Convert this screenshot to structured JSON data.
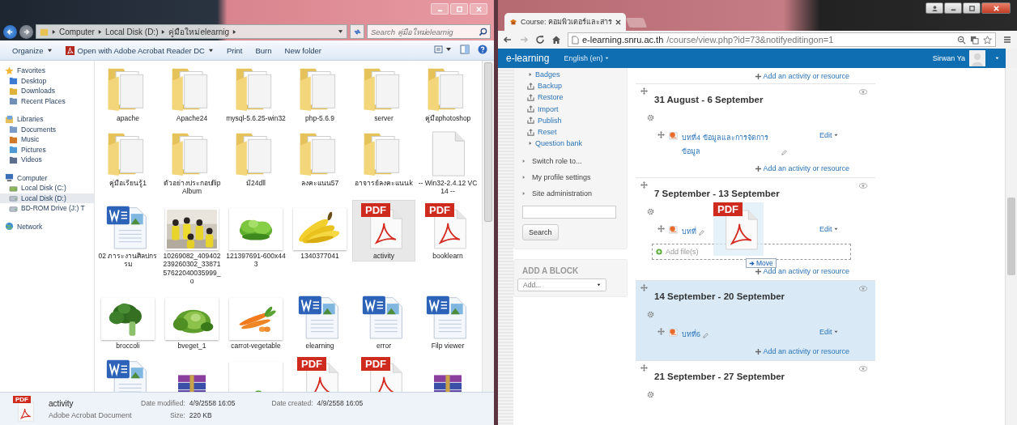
{
  "explorer": {
    "address": {
      "crumbs": [
        "Computer",
        "Local Disk (D:)",
        "คู่มือใหม่elearnig"
      ]
    },
    "search": {
      "placeholder": "Search คู่มือใหม่elearnig"
    },
    "toolbar": [
      {
        "label": "Organize",
        "dropdown": true
      },
      {
        "label": "Open with Adobe Acrobat Reader DC",
        "dropdown": true
      },
      {
        "label": "Print",
        "dropdown": false
      },
      {
        "label": "Burn",
        "dropdown": false
      },
      {
        "label": "New folder",
        "dropdown": false
      }
    ],
    "nav": [
      {
        "label": "Favorites",
        "children": [
          {
            "label": "Desktop",
            "selected": false
          },
          {
            "label": "Downloads",
            "selected": false
          },
          {
            "label": "Recent Places",
            "selected": false
          }
        ]
      },
      {
        "label": "Libraries",
        "children": [
          {
            "label": "Documents",
            "selected": false
          },
          {
            "label": "Music",
            "selected": false
          },
          {
            "label": "Pictures",
            "selected": false
          },
          {
            "label": "Videos",
            "selected": false
          }
        ]
      },
      {
        "label": "Computer",
        "children": [
          {
            "label": "Local Disk (C:)",
            "selected": false
          },
          {
            "label": "Local Disk (D:)",
            "selected": true
          },
          {
            "label": "BD-ROM Drive (J:) T",
            "selected": false
          }
        ]
      },
      {
        "label": "Network"
      }
    ],
    "files": [
      {
        "name": "apache",
        "kind": "folder",
        "selected": false
      },
      {
        "name": "Apache24",
        "kind": "folder",
        "selected": false
      },
      {
        "name": "mysql-5.6.25-win32",
        "kind": "folder",
        "selected": false
      },
      {
        "name": "php-5.6.9",
        "kind": "folder",
        "selected": false
      },
      {
        "name": "server",
        "kind": "folder",
        "selected": false
      },
      {
        "name": "คู่มือphotoshop",
        "kind": "folder",
        "selected": false
      },
      {
        "name": "คู่มือเรียนรู้1",
        "kind": "folder",
        "selected": false
      },
      {
        "name": "ตัวอย่างประกอบflip Album",
        "kind": "folder",
        "selected": false
      },
      {
        "name": "มี24dll",
        "kind": "folder",
        "selected": false
      },
      {
        "name": "ลงคะแนน57",
        "kind": "folder",
        "selected": false
      },
      {
        "name": "อาจารย์ลงคะแนนk",
        "kind": "folder",
        "selected": false
      },
      {
        "name": "-- Win32-2.4.12 VC14 --",
        "kind": "blank",
        "selected": false
      },
      {
        "name": "02 ภาระงานศิลปกรรม",
        "kind": "word",
        "selected": false
      },
      {
        "name": "10269082_409402239260302_3387157622040035999_o",
        "kind": "picture",
        "selected": false
      },
      {
        "name": "121397691-600x443",
        "kind": "picture",
        "selected": false
      },
      {
        "name": "1340377041",
        "kind": "picture",
        "selected": false
      },
      {
        "name": "activity",
        "kind": "pdf",
        "badge": "PDF",
        "selected": true
      },
      {
        "name": "booklearn",
        "kind": "pdf",
        "badge": "PDF",
        "selected": false
      },
      {
        "name": "broccoli",
        "kind": "picture",
        "selected": false
      },
      {
        "name": "bveget_1",
        "kind": "picture",
        "selected": false
      },
      {
        "name": "carrot-vegetable",
        "kind": "picture",
        "selected": false
      },
      {
        "name": "elearning",
        "kind": "word",
        "selected": false
      },
      {
        "name": "error",
        "kind": "word",
        "selected": false
      },
      {
        "name": "Filp viewer",
        "kind": "word",
        "selected": false
      },
      {
        "kind": "word",
        "selected": false
      },
      {
        "kind": "archive",
        "selected": false
      },
      {
        "kind": "picture",
        "selected": false
      },
      {
        "kind": "pdf",
        "badge": "PDF",
        "selected": false
      },
      {
        "kind": "pdf",
        "badge": "PDF",
        "selected": false
      },
      {
        "kind": "archive",
        "selected": false
      }
    ],
    "details": {
      "badge": "PDF",
      "name": "activity",
      "type": "Adobe Acrobat Document",
      "fields": [
        {
          "label": "Date modified:",
          "value": "4/9/2558 16:05"
        },
        {
          "label": "Date created:",
          "value": "4/9/2558 16:05"
        },
        {
          "label": "Size:",
          "value": "220 KB"
        }
      ]
    }
  },
  "browser": {
    "tab": {
      "title": "Course: คอมพิวเตอร์และสาร"
    },
    "url": {
      "host": "e-learning.snru.ac.th",
      "path": "/course/view.php?id=73&notifyeditingon=1"
    },
    "navbar": {
      "brand": "e-learning",
      "language": "English (en)",
      "user": "Sirwan Ya"
    },
    "admin": [
      {
        "label": "Badges",
        "kind": "branch"
      },
      {
        "label": "Backup",
        "kind": "link"
      },
      {
        "label": "Restore",
        "kind": "link"
      },
      {
        "label": "Import",
        "kind": "link"
      },
      {
        "label": "Publish",
        "kind": "link"
      },
      {
        "label": "Reset",
        "kind": "link"
      },
      {
        "label": "Question bank",
        "kind": "branch"
      }
    ],
    "settings": [
      "Switch role to...",
      "My profile settings",
      "Site administration"
    ],
    "search_button": "Search",
    "add_block": {
      "title": "ADD A BLOCK",
      "select": "Add..."
    },
    "top_add_link": "Add an activity or resource",
    "sections": [
      {
        "title": "31 August - 6 September",
        "highlighted": false,
        "activities": [
          {
            "name": "บทที่4 ข้อมูลและการจัดการข้อมูล",
            "edit": "Edit"
          }
        ],
        "add_link": "Add an activity or resource"
      },
      {
        "title": "7 September - 13 September",
        "highlighted": false,
        "activities": [
          {
            "name": "บทที่",
            "edit": "Edit"
          }
        ],
        "dropzone": "Add file(s)",
        "drag": {
          "badge": "PDF",
          "tooltip": "Move"
        },
        "add_link": "Add an activity or resource"
      },
      {
        "title": "14 September - 20 September",
        "highlighted": true,
        "activities": [
          {
            "name": "บทที่6",
            "edit": "Edit"
          }
        ],
        "add_link": "Add an activity or resource"
      },
      {
        "title": "21 September - 27 September",
        "highlighted": false
      }
    ]
  }
}
